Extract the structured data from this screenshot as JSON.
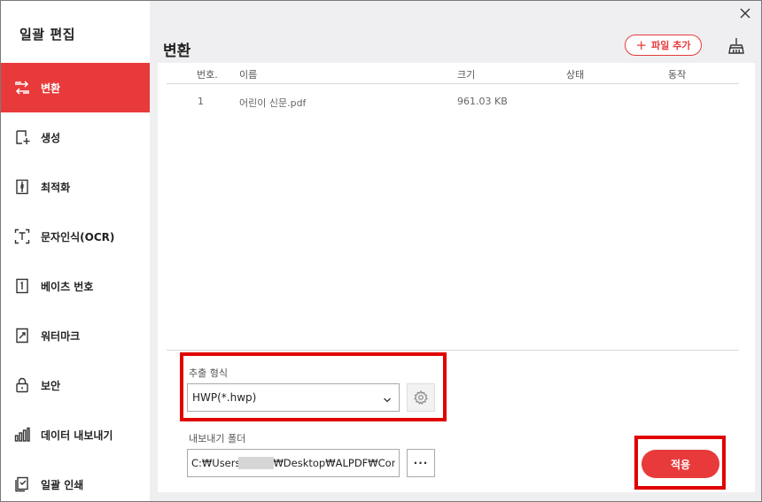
{
  "app": {
    "title": "일괄 편집"
  },
  "colors": {
    "accent": "#e83a3a",
    "highlight": "#e00000"
  },
  "sidebar": {
    "items": [
      {
        "label": "변환",
        "icon": "convert-icon",
        "active": true
      },
      {
        "label": "생성",
        "icon": "create-icon",
        "active": false
      },
      {
        "label": "최적화",
        "icon": "optimize-icon",
        "active": false
      },
      {
        "label": "문자인식(OCR)",
        "icon": "ocr-icon",
        "active": false
      },
      {
        "label": "베이츠 번호",
        "icon": "bates-number-icon",
        "active": false
      },
      {
        "label": "워터마크",
        "icon": "watermark-icon",
        "active": false
      },
      {
        "label": "보안",
        "icon": "lock-icon",
        "active": false
      },
      {
        "label": "데이터 내보내기",
        "icon": "bar-chart-icon",
        "active": false
      },
      {
        "label": "일괄 인쇄",
        "icon": "print-icon",
        "active": false
      }
    ]
  },
  "main": {
    "title": "변환",
    "add_file_label": "파일 추가",
    "table": {
      "headers": [
        "번호.",
        "이름",
        "크기",
        "상태",
        "동작"
      ],
      "rows": [
        {
          "no": "1",
          "name": "어린이 신문.pdf",
          "size": "961.03 KB",
          "status": "",
          "action": ""
        }
      ]
    },
    "format": {
      "label": "추출 형식",
      "value": "HWP(*.hwp)"
    },
    "export": {
      "label": "내보내기 폴더",
      "value": "C:₩Users₩       ₩Desktop₩ALPDF₩Conve"
    },
    "apply_label": "적용"
  }
}
